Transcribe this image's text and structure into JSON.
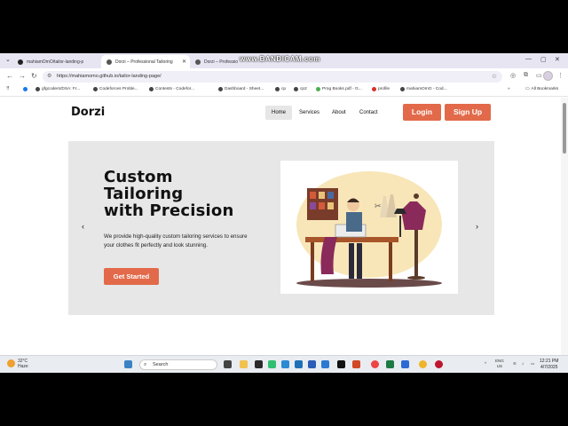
{
  "browser": {
    "tabs": [
      {
        "title": "mahiamOmO/tailor-landing-p",
        "active": false
      },
      {
        "title": "Dorzi – Professional Tailoring",
        "active": true
      },
      {
        "title": "Dorzi – Professio",
        "active": false
      }
    ],
    "recording_watermark": "www.BANDICAM.com",
    "url": "https://mahiamomo.github.io/tailor-landing-page/",
    "bookmarks": [
      "gfgcoders/DSA: Fr...",
      "Codeforces Proble...",
      "Contests - Codefor...",
      "Dashboard - Sheet...",
      "cp",
      "cp2",
      "Prog Books pdf - G...",
      "profile",
      "mahiamOmO - Cod..."
    ],
    "all_bookmarks": "All Bookmarks"
  },
  "site": {
    "logo": "Dorzi",
    "nav": [
      "Home",
      "Services",
      "About",
      "Contact"
    ],
    "login": "Login",
    "signup": "Sign Up",
    "hero": {
      "title_line1": "Custom",
      "title_line2": "Tailoring",
      "title_line3": "with Precision",
      "description": "We provide high-quality custom tailoring services to ensure your clothes fit perfectly and look stunning.",
      "cta": "Get Started",
      "prev": "‹",
      "next": "›"
    }
  },
  "taskbar": {
    "weather_temp": "32°C",
    "weather_desc": "Haze",
    "search_placeholder": "Search",
    "lang_line1": "ENG",
    "lang_line2": "US",
    "time": "12:21 PM",
    "date": "4/7/2025"
  },
  "colors": {
    "accent": "#e26a4a",
    "hero_bg": "#e7e7e7",
    "tabstrip": "#e8e5f3"
  }
}
